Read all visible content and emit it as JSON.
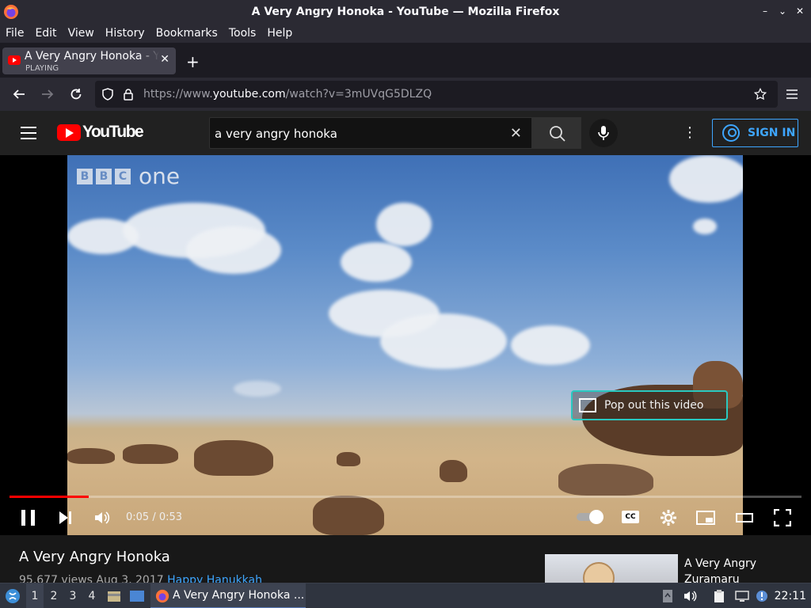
{
  "window": {
    "title": "A Very Angry Honoka - YouTube — Mozilla Firefox",
    "controls": [
      "–",
      "⌄",
      "✕"
    ]
  },
  "menubar": [
    "File",
    "Edit",
    "View",
    "History",
    "Bookmarks",
    "Tools",
    "Help"
  ],
  "tab": {
    "title": "A Very Angry Honoka - YouTube",
    "status": "PLAYING",
    "close": "✕",
    "new_tab": "+"
  },
  "navbar": {
    "url_prefix": "https://www.",
    "url_domain": "youtube.com",
    "url_path": "/watch?v=3mUVqG5DLZQ"
  },
  "youtube": {
    "logo_text": "YouTube",
    "search_query": "a very angry honoka",
    "sign_in": "SIGN IN"
  },
  "video": {
    "watermark_letters": [
      "B",
      "B",
      "C"
    ],
    "watermark_channel": "one",
    "popout_label": "Pop out this video",
    "time": "0:05 / 0:53",
    "progress": 0.1,
    "cc_label": "CC"
  },
  "below": {
    "title": "A Very Angry Honoka",
    "views_date": "95,677 views  Aug 3, 2017",
    "hashtag": "Happy Hanukkah",
    "rec_title_line1": "A Very Angry",
    "rec_title_line2": "Zuramaru"
  },
  "taskbar": {
    "workspaces": [
      "1",
      "2",
      "3",
      "4"
    ],
    "window_label": "A Very Angry Honoka ...",
    "clock": "22:11"
  },
  "colors": {
    "accent_blue": "#3ea6ff",
    "youtube_red": "#ff0000",
    "popout_border": "#29c8c0"
  }
}
